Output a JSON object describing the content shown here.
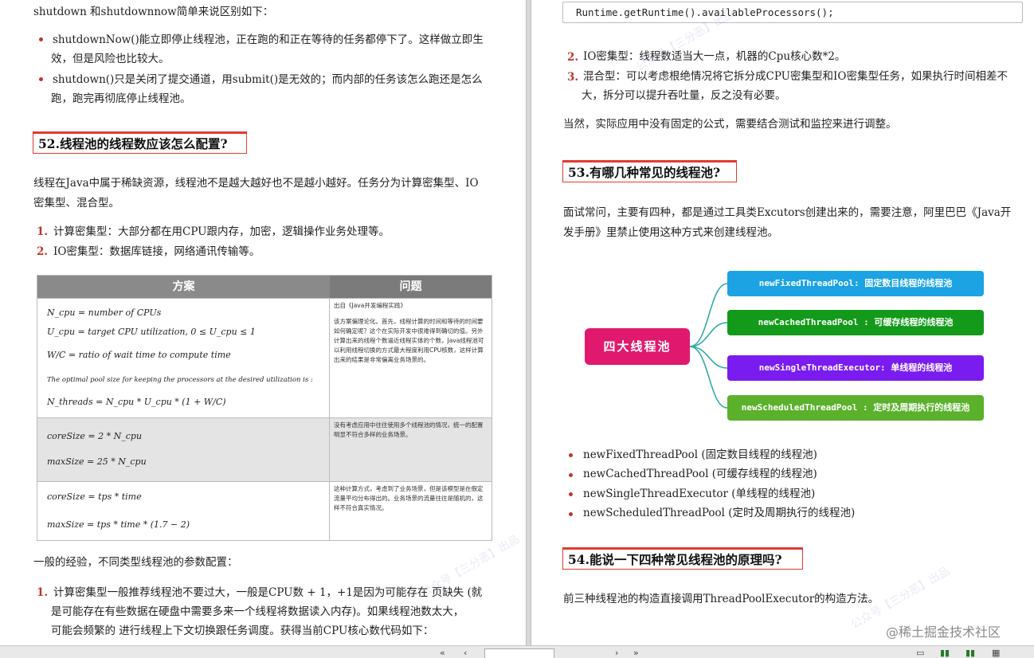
{
  "left": {
    "intro": "shutdown 和shutdownnow简单来说区别如下：",
    "bullets": [
      {
        "line1": "shutdownNow()能立即停止线程池，正在跑的和正在等待的任务都停下了。这样做立即生",
        "line2": "效，但是风险也比较大。"
      },
      {
        "line1": "shutdown()只是关闭了提交通道，用submit()是无效的；而内部的任务该怎么跑还是怎么",
        "line2": "跑，跑完再彻底停止线程池。"
      }
    ],
    "heading52": "52.线程池的线程数应该怎么配置?",
    "para52_line1": "线程在Java中属于稀缺资源，线程池不是越大越好也不是越小越好。任务分为计算密集型、IO",
    "para52_line2": "密集型、混合型。",
    "types": [
      {
        "num": "1.",
        "text": "计算密集型：大部分都在用CPU跟内存，加密，逻辑操作业务处理等。"
      },
      {
        "num": "2.",
        "text": "IO密集型：数据库链接，网络通讯传输等。"
      }
    ],
    "table": {
      "col1": "方案",
      "col2": "问题",
      "rows": [
        {
          "formulas": [
            "N_cpu = number of CPUs",
            "U_cpu = target CPU utilization, 0 ≤ U_cpu ≤ 1",
            "W/C = ratio of wait time to compute time",
            "The optimal pool size for keeping the processors at the desired utilization is :",
            "N_threads = N_cpu * U_cpu * (1 + W/C)"
          ],
          "note_title": "出自《Java并发编程实践》",
          "note": "该方案偏理论化。首先，线程计算的时间和等待的时间要如何确定呢？这个在实际开发中很难得到确切的值。另外计算出来的线程个数逼近线程实体的个数，Java线程池可以利用线程切换的方式最大程度利用CPU核数，这样计算出来的结果是非常偏离业务场景的。"
        },
        {
          "formulas": [
            "coreSize = 2 * N_cpu",
            "maxSize = 25 * N_cpu"
          ],
          "note": "没有考虑应用中往往使用多个线程池的情况，统一的配置明显不符合多样的业务场景。"
        },
        {
          "formulas": [
            "coreSize = tps * time",
            "maxSize = tps * time * (1.7 − 2)"
          ],
          "note": "这种计算方式，考虑到了业务场景，但是该模型是在假定流量平均分布得出的。业务场景的流量往往是随机的，这样不符合真实情况。"
        }
      ]
    },
    "experience": "一般的经验，不同类型线程池的参数配置：",
    "exp1_num": "1.",
    "exp1_lines": [
      "计算密集型一般推荐线程池不要过大，一般是CPU数 + 1，+1是因为可能存在 页缺失 (就",
      "是可能存在有些数据在硬盘中需要多来一个线程将数据读入内存)。如果线程池数太大，",
      "可能会频繁的 进行线程上下文切换跟任务调度。获得当前CPU核心数代码如下："
    ]
  },
  "right": {
    "code": "Runtime.getRuntime().availableProcessors();",
    "items": [
      {
        "num": "2.",
        "line1": "IO密集型：线程数适当大一点，机器的Cpu核心数*2。"
      },
      {
        "num": "3.",
        "line1": "混合型：可以考虑根绝情况将它拆分成CPU密集型和IO密集型任务，如果执行时间相差不",
        "line2": "大，拆分可以提升吞吐量，反之没有必要。"
      }
    ],
    "note": "当然，实际应用中没有固定的公式，需要结合测试和监控来进行调整。",
    "heading53": "53.有哪几种常见的线程池?",
    "para53_line1": "面试常问，主要有四种，都是通过工具类Excutors创建出来的，需要注意，阿里巴巴《Java开",
    "para53_line2": "发手册》里禁止使用这种方式来创建线程池。",
    "mindmap": {
      "center": "四大线程池",
      "leaves": [
        {
          "text": "newFixedThreadPool: 固定数目线程的线程池",
          "color": "#1ba3e3"
        },
        {
          "text": "newCachedThreadPool : 可缓存线程的线程池",
          "color": "#139a1a"
        },
        {
          "text": "newSingleThreadExecutor: 单线程的线程池",
          "color": "#7a1cf0"
        },
        {
          "text": "newScheduledThreadPool : 定时及周期执行的线程池",
          "color": "#5bb02c"
        }
      ],
      "line_color": "#2aa7a0",
      "center_color": "#e0196e"
    },
    "pool_list": [
      "newFixedThreadPool (固定数目线程的线程池)",
      "newCachedThreadPool (可缓存线程的线程池)",
      "newSingleThreadExecutor (单线程的线程池)",
      "newScheduledThreadPool (定时及周期执行的线程池)"
    ],
    "heading54": "54.能说一下四种常见线程池的原理吗?",
    "para54": "前三种线程池的构造直接调用ThreadPoolExecutor的构造方法。",
    "site_mark": "@稀土掘金技术社区"
  },
  "accent_color": "#c2352e"
}
